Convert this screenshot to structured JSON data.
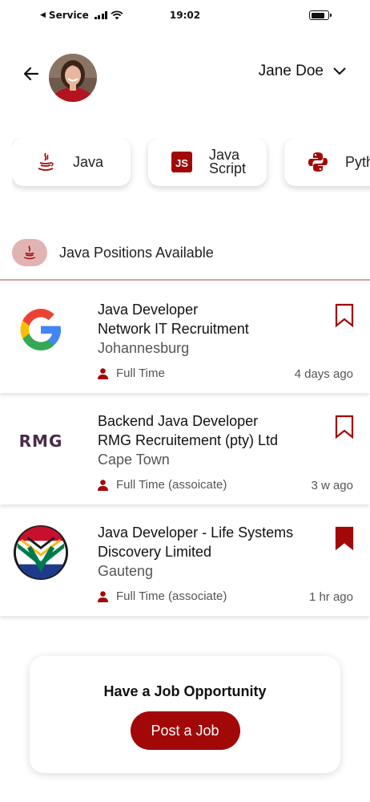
{
  "status_bar": {
    "carrier": "Service",
    "time": "19:02"
  },
  "header": {
    "back_icon": "arrow-left-icon",
    "user_name": "Jane Doe",
    "dropdown_icon": "chevron-down-icon"
  },
  "skills": [
    {
      "label": "Java",
      "icon": "java-icon"
    },
    {
      "label": "Java Script",
      "icon": "js-icon"
    },
    {
      "label": "Pyth",
      "icon": "python-icon"
    }
  ],
  "section": {
    "title": "Java Positions Available",
    "icon": "java-icon"
  },
  "jobs": [
    {
      "title": "Java Developer",
      "company": "Network IT Recruitment",
      "location": "Johannesburg",
      "type": "Full Time",
      "age": "4 days ago",
      "logo": "google-logo",
      "bookmarked": false
    },
    {
      "title": "Backend Java Developer",
      "company": "RMG Recruitement (pty) Ltd",
      "location": "Cape Town",
      "type": "Full Time (assoicate)",
      "age": "3 w ago",
      "logo": "rmg-logo",
      "logo_text": "RMG",
      "bookmarked": false
    },
    {
      "title": "Java Developer - Life Systems",
      "company": "Discovery Limited",
      "location": "Gauteng",
      "type": "Full Time (associate)",
      "age": "1 hr ago",
      "logo": "discovery-shield-logo",
      "bookmarked": true
    }
  ],
  "cta": {
    "title": "Have a Job Opportunity",
    "button": "Post a Job"
  },
  "colors": {
    "accent": "#a30808",
    "badge_bg": "#e2b3b3",
    "divider": "#d9a3a3"
  }
}
